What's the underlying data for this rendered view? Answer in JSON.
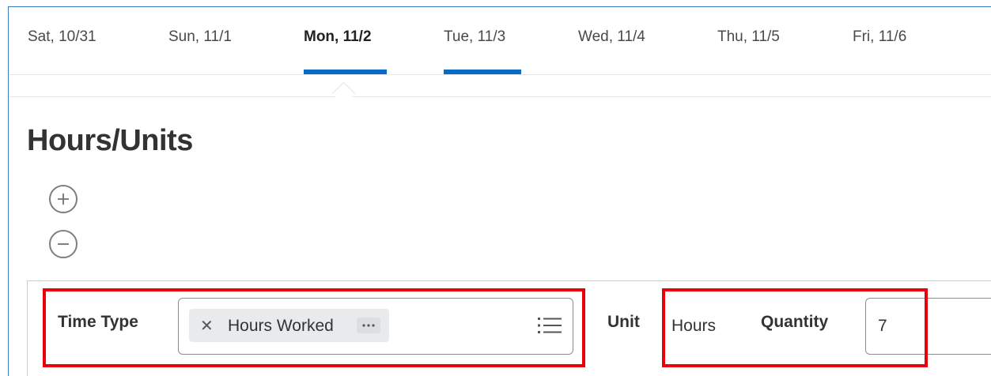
{
  "day_tabs": [
    {
      "label": "Sat, 10/31"
    },
    {
      "label": "Sun, 11/1"
    },
    {
      "label": "Mon, 11/2"
    },
    {
      "label": "Tue, 11/3"
    },
    {
      "label": "Wed, 11/4"
    },
    {
      "label": "Thu, 11/5"
    },
    {
      "label": "Fri, 11/6"
    }
  ],
  "active_tab": "Mon, 11/2",
  "hovered_tab": "Tue, 11/3",
  "section": {
    "title": "Hours/Units",
    "add_icon": "plus-circle-icon",
    "remove_icon": "minus-circle-icon"
  },
  "row": {
    "time_type_label": "Time Type",
    "time_type_value": "Hours Worked",
    "remove_icon": "close-icon",
    "more_icon": "ellipsis-icon",
    "prompt_icon": "list-icon",
    "unit_label": "Unit",
    "unit_value": "Hours",
    "quantity_label": "Quantity",
    "quantity_value": "7"
  },
  "colors": {
    "accent": "#0b6bc4",
    "highlight": "#e8000d",
    "frame": "#3b7bbf"
  }
}
